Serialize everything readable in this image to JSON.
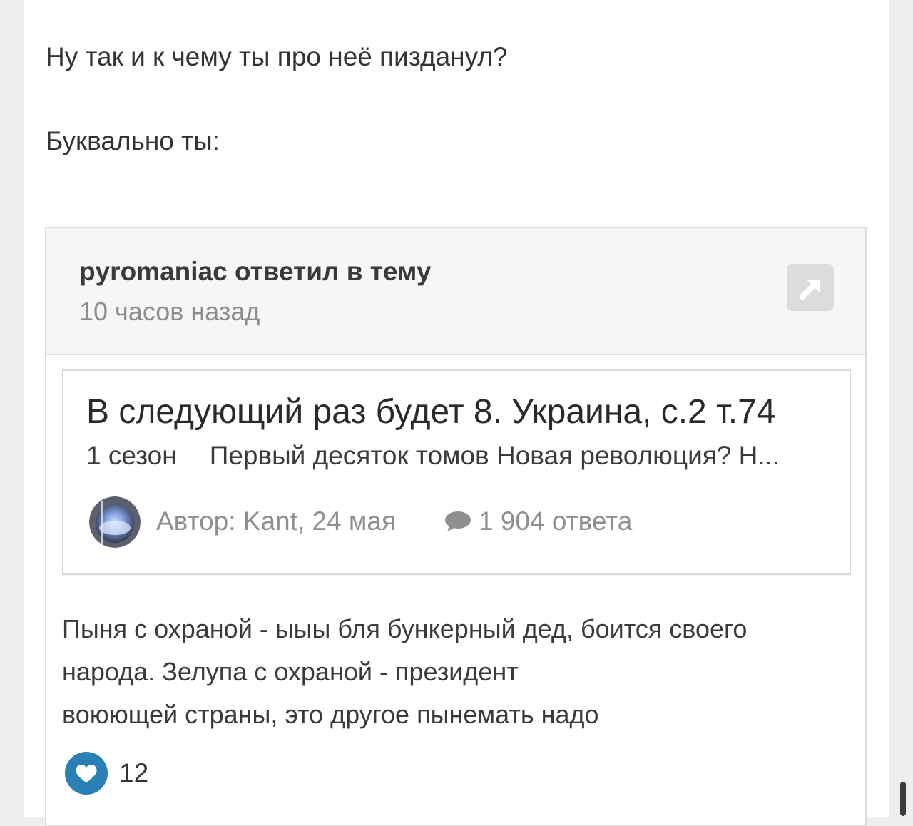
{
  "post": {
    "paragraph_1": "Ну так и к чему ты про неё пизданул?",
    "paragraph_2": "Буквально ты:"
  },
  "quote": {
    "header": {
      "author_line": "pyromaniac ответил в тему",
      "time": "10 часов назад",
      "jump_icon": "arrow-up-right-icon"
    },
    "topic": {
      "title": "В следующий раз будет 8. Украина, с.2 т.74",
      "snippet_season": "1 сезон",
      "snippet_text": "Первый десяток томов Новая революция? Н...",
      "meta": "Автор: Kant, 24 мая",
      "replies": "1 904 ответа",
      "replies_icon": "speech-bubble-icon"
    },
    "body": {
      "line_1": "Пыня с охраной - ыыы бля бункерный дед, боится своего",
      "line_2": "народа. Зелупа с охраной - президент",
      "line_3": "воюющей страны, это другое пынемать надо"
    },
    "reaction": {
      "icon": "heart-icon",
      "count": "12",
      "color": "#2a7fb5"
    }
  }
}
